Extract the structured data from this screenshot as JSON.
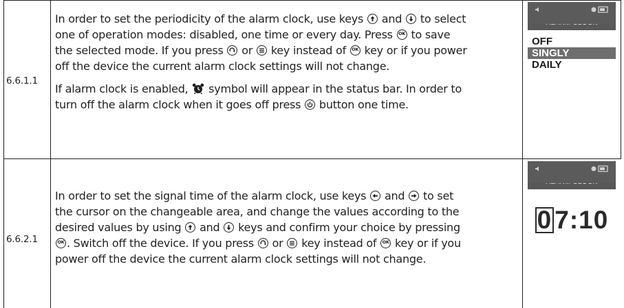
{
  "rows": [
    {
      "number": "6.6.1.1",
      "paragraphs": [
        {
          "line1a": "In order to set the periodicity of the alarm clock, use keys",
          "line1b": "and",
          "line1c": "to select",
          "line2": "one of operation modes: disabled, one time or every day. Press",
          "line2b": "to save",
          "line3a": "the selected mode. If you press",
          "line3b": "or",
          "line3c": "key instead of",
          "line3d": "key or if you power",
          "line4": "off the device the current alarm clock settings will not change."
        },
        {
          "line1a": "If alarm clock is enabled,",
          "line1b": "symbol will appear in the status bar. In order to",
          "line2a": "turn off the alarm clock when it goes off press",
          "line2b": "button one time."
        }
      ],
      "screen": {
        "title": "ALARM CLOCK",
        "items": [
          "OFF",
          "SINGLY",
          "DAILY"
        ],
        "selected_index": 1
      }
    },
    {
      "number": "6.6.2.1",
      "paragraph": {
        "line1a": "In order to set the signal time of the alarm clock, use keys",
        "line1b": "and",
        "line1c": "to set",
        "line2": "the cursor on the changeable area, and change the values according to the",
        "line3a": "desired values by using",
        "line3b": "and",
        "line3c": "keys and confirm your choice by pressing",
        "line4a": ". Switch off the device. If you press",
        "line4b": "or",
        "line4c": "key instead of",
        "line4d": "key or if you",
        "line5": "power off the device the current alarm clock settings will not change."
      },
      "screen": {
        "title": "ALARM CLOCK",
        "time_cursor_digit": "0",
        "time_rest": "7:10"
      }
    }
  ],
  "icons": {
    "up": "arrow-up-key-icon",
    "down": "arrow-down-key-icon",
    "left": "arrow-left-key-icon",
    "right": "arrow-right-key-icon",
    "ok": "ok-key-icon",
    "back": "back-key-icon",
    "menu": "menu-key-icon",
    "power": "power-button-icon",
    "alarm": "alarm-clock-icon"
  },
  "key_ok_label": "OK",
  "colors": {
    "text": "#231f20",
    "screen_header": "#5b5b5b",
    "selected": "#6e6e6e"
  }
}
